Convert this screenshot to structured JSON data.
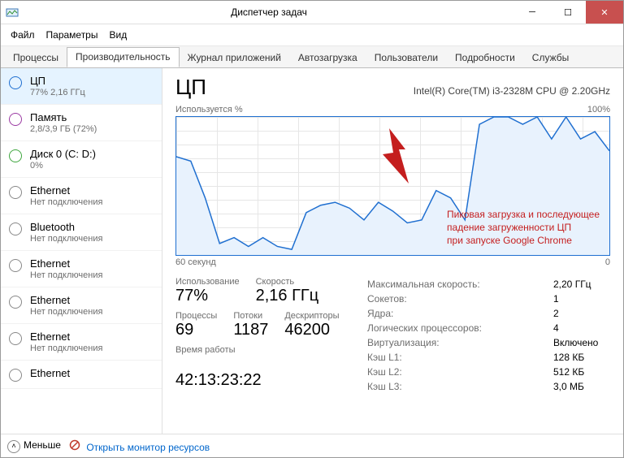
{
  "window": {
    "title": "Диспетчер задач"
  },
  "menubar": {
    "file": "Файл",
    "options": "Параметры",
    "view": "Вид"
  },
  "tabs": [
    "Процессы",
    "Производительность",
    "Журнал приложений",
    "Автозагрузка",
    "Пользователи",
    "Подробности",
    "Службы"
  ],
  "active_tab": 1,
  "sidebar": {
    "items": [
      {
        "name": "ЦП",
        "sub": "77% 2,16 ГГц",
        "ring": "blue",
        "selected": true
      },
      {
        "name": "Память",
        "sub": "2,8/3,9 ГБ (72%)",
        "ring": "purple"
      },
      {
        "name": "Диск 0 (C: D:)",
        "sub": "0%",
        "ring": "green"
      },
      {
        "name": "Ethernet",
        "sub": "Нет подключения",
        "ring": ""
      },
      {
        "name": "Bluetooth",
        "sub": "Нет подключения",
        "ring": ""
      },
      {
        "name": "Ethernet",
        "sub": "Нет подключения",
        "ring": ""
      },
      {
        "name": "Ethernet",
        "sub": "Нет подключения",
        "ring": ""
      },
      {
        "name": "Ethernet",
        "sub": "Нет подключения",
        "ring": ""
      },
      {
        "name": "Ethernet",
        "sub": "",
        "ring": ""
      }
    ]
  },
  "detail": {
    "title": "ЦП",
    "cpu_name": "Intel(R) Core(TM) i3-2328M CPU @ 2.20GHz",
    "chart_top_left": "Используется %",
    "chart_top_right": "100%",
    "chart_bottom_left": "60 секунд",
    "chart_bottom_right": "0",
    "annotation": "Пиковая загрузка и последующее\nпадение загруженности ЦП\nпри запуске Google Chrome"
  },
  "stats_left": {
    "util_label": "Использование",
    "util_val": "77%",
    "speed_label": "Скорость",
    "speed_val": "2,16 ГГц",
    "proc_label": "Процессы",
    "proc_val": "69",
    "threads_label": "Потоки",
    "threads_val": "1187",
    "handles_label": "Дескрипторы",
    "handles_val": "46200",
    "uptime_label": "Время работы",
    "uptime_val": "42:13:23:22"
  },
  "stats_right": {
    "max_speed_lbl": "Максимальная скорость:",
    "max_speed_val": "2,20 ГГц",
    "sockets_lbl": "Сокетов:",
    "sockets_val": "1",
    "cores_lbl": "Ядра:",
    "cores_val": "2",
    "lprocs_lbl": "Логических процессоров:",
    "lprocs_val": "4",
    "virt_lbl": "Виртуализация:",
    "virt_val": "Включено",
    "l1_lbl": "Кэш L1:",
    "l1_val": "128 КБ",
    "l2_lbl": "Кэш L2:",
    "l2_val": "512 КБ",
    "l3_lbl": "Кэш L3:",
    "l3_val": "3,0 МБ"
  },
  "footer": {
    "less": "Меньше",
    "open_monitor": "Открыть монитор ресурсов"
  },
  "chart_data": {
    "type": "line",
    "xlabel": "секунды (0…60)",
    "ylabel": "Используется %",
    "ylim": [
      0,
      100
    ],
    "x": [
      0,
      2,
      4,
      6,
      8,
      10,
      12,
      14,
      16,
      18,
      20,
      22,
      24,
      26,
      28,
      30,
      32,
      34,
      36,
      38,
      40,
      42,
      44,
      46,
      48,
      50,
      52,
      54,
      56,
      58,
      60
    ],
    "values": [
      73,
      70,
      45,
      14,
      18,
      12,
      18,
      12,
      10,
      35,
      40,
      42,
      38,
      30,
      42,
      36,
      28,
      30,
      50,
      45,
      30,
      95,
      100,
      100,
      95,
      100,
      85,
      100,
      85,
      90,
      77
    ],
    "title": "ЦП — Используется %"
  }
}
